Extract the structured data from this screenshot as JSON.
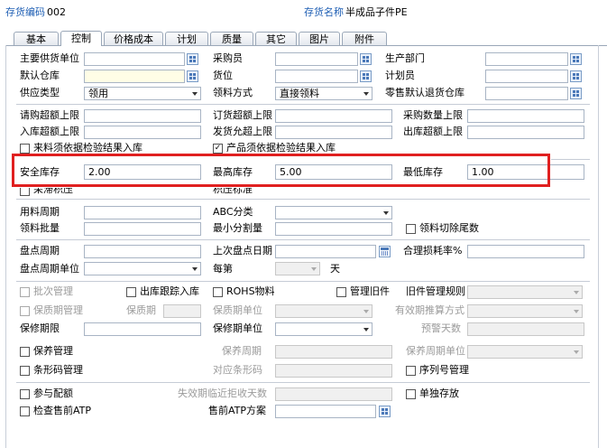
{
  "header": {
    "code_label": "存货编码",
    "code_value": "002",
    "name_label": "存货名称",
    "name_value": "半成品子件PE"
  },
  "tabs": [
    "基本",
    "控制",
    "价格成本",
    "计划",
    "质量",
    "其它",
    "图片",
    "附件"
  ],
  "active_tab": "控制",
  "section1": {
    "main_supplier": "主要供货单位",
    "buyer": "采购员",
    "production_dept": "生产部门",
    "default_warehouse": "默认仓库",
    "location": "货位",
    "planner": "计划员",
    "supply_type": "供应类型",
    "supply_type_value": "领用",
    "picking_method": "领料方式",
    "picking_method_value": "直接领料",
    "retail_return_wh": "零售默认退货仓库"
  },
  "section2": {
    "requisition_over_limit": "请购超额上限",
    "order_over_limit": "订货超额上限",
    "purchase_qty_limit": "采购数量上限",
    "inbound_over_limit": "入库超额上限",
    "ship_over_limit": "发货允超上限",
    "outbound_over_limit": "出库超额上限",
    "incoming_inspection": "来料须依据检验结果入库",
    "product_inspection": "产品须依据检验结果入库"
  },
  "stock": {
    "safety_label": "安全库存",
    "safety_value": "2.00",
    "max_label": "最高库存",
    "max_value": "5.00",
    "min_label": "最低库存",
    "min_value": "1.00",
    "hidden_left": "呆滞积压",
    "hidden_mid": "积压标准"
  },
  "section3": {
    "usage_period": "用料周期",
    "abc_class": "ABC分类",
    "picking_batch": "领料批量",
    "min_split_qty": "最小分割量",
    "picking_cut_tail": "领料切除尾数"
  },
  "section4": {
    "count_cycle": "盘点周期",
    "last_count_date": "上次盘点日期",
    "reasonable_loss_rate": "合理损耗率%",
    "count_cycle_unit": "盘点周期单位",
    "every": "每第",
    "day": "天"
  },
  "section5": {
    "batch_mgmt": "批次管理",
    "outbound_tracking": "出库跟踪入库",
    "rohs": "ROHS物料",
    "manage_old": "管理旧件",
    "old_rule": "旧件管理规则",
    "shelf_life_mgmt": "保质期管理",
    "shelf_life": "保质期",
    "shelf_life_unit": "保质期单位",
    "expiry_calc": "有效期推算方式",
    "warranty_period": "保修期限",
    "warranty_unit": "保修期单位",
    "warning_days": "预警天数",
    "maintenance_mgmt": "保养管理",
    "maintenance_cycle": "保养周期",
    "maintenance_cycle_unit": "保养周期单位",
    "barcode_mgmt": "条形码管理",
    "barcode_ref": "对应条形码",
    "serial_mgmt": "序列号管理"
  },
  "section6": {
    "participate_allocation": "参与配额",
    "expiry_reject_days": "失效期临近拒收天数",
    "separate_storage": "单独存放",
    "presale_atp_check": "检查售前ATP",
    "presale_atp_plan": "售前ATP方案"
  },
  "colors": {
    "header_label": "#1f5fb4",
    "highlight_box": "#e02020"
  }
}
